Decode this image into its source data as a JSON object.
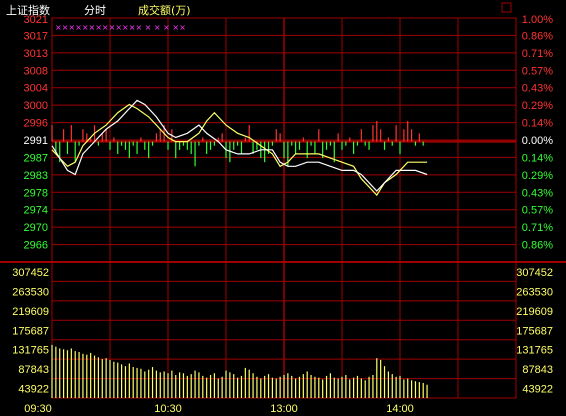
{
  "header": {
    "index_name": "上证指数",
    "mode": "分时",
    "volume_label": "成交额(万)",
    "marker_text": "×××××××××××××  ×  ×  ×    ××"
  },
  "colors": {
    "background": "#000000",
    "grid": "#a00000",
    "up": "#ff3333",
    "down": "#33ff33",
    "neutral": "#ffffff",
    "price_line": "#ffffff",
    "avg_line": "#ffff66",
    "volume": "#ffff66",
    "marker": "#ff33ff"
  },
  "chart_data": {
    "type": "line",
    "prev_close": 2991,
    "price_ticks": [
      "3021",
      "3017",
      "3013",
      "3008",
      "3004",
      "3000",
      "2996",
      "2991",
      "2987",
      "2983",
      "2978",
      "2974",
      "2970",
      "2966"
    ],
    "pct_ticks": [
      "1.00%",
      "0.86%",
      "0.71%",
      "0.57%",
      "0.43%",
      "0.29%",
      "0.14%",
      "0.00%",
      "0.14%",
      "0.29%",
      "0.43%",
      "0.57%",
      "0.71%",
      "0.86%"
    ],
    "volume_ticks": [
      "307452",
      "263530",
      "219609",
      "175687",
      "131765",
      "87843",
      "43922"
    ],
    "time_ticks": [
      "09:30",
      "10:30",
      "13:00",
      "14:00"
    ],
    "ylim": [
      2966,
      3021
    ],
    "volume_ylim": [
      0,
      307452
    ],
    "x_minutes_total": 240,
    "price_series": {
      "name": "price",
      "points": [
        [
          0,
          2990
        ],
        [
          4,
          2987
        ],
        [
          8,
          2984
        ],
        [
          12,
          2983
        ],
        [
          16,
          2988
        ],
        [
          22,
          2991
        ],
        [
          28,
          2994
        ],
        [
          34,
          2996
        ],
        [
          40,
          2999
        ],
        [
          44,
          3001
        ],
        [
          48,
          3000
        ],
        [
          54,
          2997
        ],
        [
          60,
          2993
        ],
        [
          64,
          2992
        ],
        [
          70,
          2993
        ],
        [
          76,
          2995
        ],
        [
          80,
          2993
        ],
        [
          86,
          2991
        ],
        [
          90,
          2989
        ],
        [
          96,
          2988
        ],
        [
          102,
          2988
        ],
        [
          108,
          2989
        ],
        [
          114,
          2989
        ],
        [
          118,
          2986
        ],
        [
          122,
          2985
        ],
        [
          126,
          2985
        ],
        [
          132,
          2986
        ],
        [
          138,
          2986
        ],
        [
          144,
          2985
        ],
        [
          150,
          2984
        ],
        [
          156,
          2984
        ],
        [
          160,
          2983
        ],
        [
          164,
          2981
        ],
        [
          168,
          2979
        ],
        [
          172,
          2981
        ],
        [
          178,
          2984
        ],
        [
          184,
          2984
        ],
        [
          188,
          2984
        ],
        [
          194,
          2983
        ]
      ]
    },
    "avg_series": {
      "name": "average",
      "points": [
        [
          0,
          2989
        ],
        [
          4,
          2987
        ],
        [
          8,
          2985
        ],
        [
          12,
          2986
        ],
        [
          16,
          2990
        ],
        [
          22,
          2993
        ],
        [
          28,
          2995
        ],
        [
          34,
          2998
        ],
        [
          40,
          3000
        ],
        [
          44,
          2999
        ],
        [
          50,
          2997
        ],
        [
          54,
          2995
        ],
        [
          60,
          2992
        ],
        [
          64,
          2991
        ],
        [
          70,
          2991
        ],
        [
          76,
          2993
        ],
        [
          80,
          2996
        ],
        [
          84,
          2998
        ],
        [
          90,
          2995
        ],
        [
          96,
          2993
        ],
        [
          102,
          2992
        ],
        [
          108,
          2990
        ],
        [
          114,
          2988
        ],
        [
          118,
          2985
        ],
        [
          122,
          2986
        ],
        [
          126,
          2988
        ],
        [
          132,
          2988
        ],
        [
          138,
          2988
        ],
        [
          144,
          2987
        ],
        [
          150,
          2986
        ],
        [
          156,
          2985
        ],
        [
          160,
          2982
        ],
        [
          164,
          2980
        ],
        [
          168,
          2978
        ],
        [
          172,
          2981
        ],
        [
          178,
          2983
        ],
        [
          184,
          2986
        ],
        [
          188,
          2986
        ],
        [
          194,
          2986
        ]
      ]
    },
    "diff_bars": [
      [
        0,
        2995
      ],
      [
        2,
        2988
      ],
      [
        4,
        2986
      ],
      [
        6,
        2994
      ],
      [
        8,
        2988
      ],
      [
        10,
        2995
      ],
      [
        12,
        2986
      ],
      [
        14,
        2990
      ],
      [
        16,
        2994
      ],
      [
        18,
        2993
      ],
      [
        20,
        2992
      ],
      [
        22,
        2995
      ],
      [
        24,
        2990
      ],
      [
        26,
        2993
      ],
      [
        28,
        2994
      ],
      [
        30,
        2989
      ],
      [
        32,
        2992
      ],
      [
        34,
        2988
      ],
      [
        36,
        2990
      ],
      [
        38,
        2989
      ],
      [
        40,
        2987
      ],
      [
        42,
        2990
      ],
      [
        44,
        2988
      ],
      [
        46,
        2992
      ],
      [
        48,
        2989
      ],
      [
        50,
        2987
      ],
      [
        52,
        2990
      ],
      [
        54,
        2993
      ],
      [
        56,
        2994
      ],
      [
        58,
        2995
      ],
      [
        60,
        2989
      ],
      [
        62,
        2994
      ],
      [
        64,
        2987
      ],
      [
        66,
        2989
      ],
      [
        68,
        2990
      ],
      [
        70,
        2989
      ],
      [
        72,
        2988
      ],
      [
        74,
        2985
      ],
      [
        76,
        2990
      ],
      [
        78,
        2992
      ],
      [
        80,
        2988
      ],
      [
        82,
        2989
      ],
      [
        84,
        2990
      ],
      [
        86,
        2992
      ],
      [
        88,
        2993
      ],
      [
        90,
        2987
      ],
      [
        92,
        2986
      ],
      [
        94,
        2989
      ],
      [
        96,
        2990
      ],
      [
        98,
        2988
      ],
      [
        100,
        2992
      ],
      [
        102,
        2995
      ],
      [
        104,
        2988
      ],
      [
        106,
        2989
      ],
      [
        108,
        2987
      ],
      [
        110,
        2986
      ],
      [
        112,
        2988
      ],
      [
        114,
        2990
      ],
      [
        116,
        2994
      ],
      [
        118,
        2993
      ],
      [
        120,
        2987
      ],
      [
        122,
        2985
      ],
      [
        124,
        2990
      ],
      [
        126,
        2988
      ],
      [
        128,
        2989
      ],
      [
        130,
        2992
      ],
      [
        132,
        2987
      ],
      [
        134,
        2990
      ],
      [
        136,
        2988
      ],
      [
        138,
        2994
      ],
      [
        140,
        2987
      ],
      [
        142,
        2989
      ],
      [
        144,
        2990
      ],
      [
        146,
        2986
      ],
      [
        148,
        2993
      ],
      [
        150,
        2989
      ],
      [
        152,
        2990
      ],
      [
        154,
        2992
      ],
      [
        156,
        2988
      ],
      [
        158,
        2990
      ],
      [
        160,
        2994
      ],
      [
        162,
        2990
      ],
      [
        164,
        2989
      ],
      [
        166,
        2995
      ],
      [
        168,
        2996
      ],
      [
        170,
        2994
      ],
      [
        172,
        2989
      ],
      [
        174,
        2992
      ],
      [
        176,
        2990
      ],
      [
        178,
        2995
      ],
      [
        180,
        2988
      ],
      [
        182,
        2994
      ],
      [
        184,
        2996
      ],
      [
        186,
        2994
      ],
      [
        188,
        2990
      ],
      [
        190,
        2993
      ],
      [
        192,
        2990
      ],
      [
        194,
        2991
      ]
    ],
    "volume_bars": [
      120000,
      116000,
      112000,
      110000,
      108000,
      112000,
      106000,
      104000,
      100000,
      98000,
      102000,
      96000,
      92000,
      88000,
      90000,
      86000,
      82000,
      80000,
      76000,
      72000,
      78000,
      70000,
      68000,
      66000,
      60000,
      64000,
      70000,
      62000,
      58000,
      60000,
      56000,
      62000,
      52000,
      58000,
      56000,
      50000,
      54000,
      62000,
      58000,
      50000,
      46000,
      52000,
      56000,
      44000,
      48000,
      62000,
      58000,
      54000,
      46000,
      50000,
      68000,
      64000,
      56000,
      48000,
      44000,
      50000,
      54000,
      46000,
      44000,
      48000,
      52000,
      56000,
      50000,
      44000,
      48000,
      54000,
      60000,
      52000,
      48000,
      46000,
      42000,
      50000,
      56000,
      46000,
      44000,
      48000,
      52000,
      42000,
      46000,
      50000,
      44000,
      40000,
      48000,
      52000,
      90000,
      86000,
      72000,
      60000,
      54000,
      48000,
      50000,
      42000,
      44000,
      40000,
      38000,
      36000,
      34000,
      30000
    ]
  }
}
